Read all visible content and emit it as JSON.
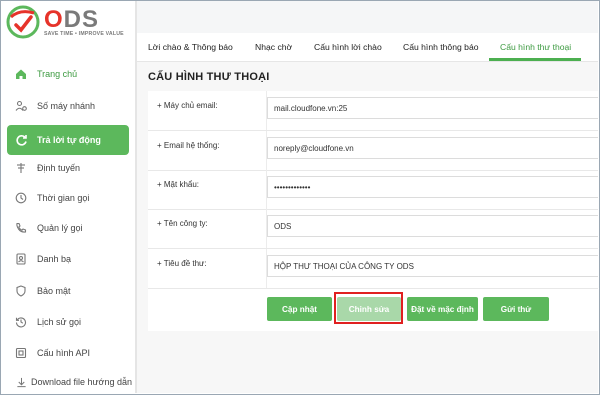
{
  "brand": {
    "logo_text": "ODS",
    "slogan": "SAVE TIME • IMPROVE VALUE",
    "colors": {
      "accent_green": "#5cb85c",
      "logo_red": "#e6332a",
      "logo_gray": "#7a7a7a",
      "highlight_red": "#e02020"
    }
  },
  "sidebar": {
    "items": [
      {
        "label": "Trang chủ",
        "icon": "home-icon",
        "active": false
      },
      {
        "label": "Số máy nhánh",
        "icon": "users-icon",
        "active": false
      },
      {
        "label": "Trả lời tự động",
        "icon": "refresh-icon",
        "active": true
      },
      {
        "label": "Định tuyến",
        "icon": "signpost-icon",
        "active": false
      },
      {
        "label": "Thời gian gọi",
        "icon": "clock-icon",
        "active": false
      },
      {
        "label": "Quản lý gọi",
        "icon": "phone-icon",
        "active": false
      },
      {
        "label": "Danh bạ",
        "icon": "contacts-icon",
        "active": false
      },
      {
        "label": "Bảo mật",
        "icon": "shield-icon",
        "active": false
      },
      {
        "label": "Lịch sử gọi",
        "icon": "history-icon",
        "active": false
      },
      {
        "label": "Cấu hình API",
        "icon": "api-icon",
        "active": false
      },
      {
        "label": "Download file hướng dẫn",
        "icon": "download-icon",
        "active": false
      }
    ]
  },
  "tabs": [
    {
      "label": "Lời chào & Thông báo",
      "active": false
    },
    {
      "label": "Nhạc chờ",
      "active": false
    },
    {
      "label": "Cấu hình lời chào",
      "active": false
    },
    {
      "label": "Cấu hình thông báo",
      "active": false
    },
    {
      "label": "Cấu hình thư thoại",
      "active": true
    }
  ],
  "page": {
    "title": "CẤU HÌNH THƯ THOẠI"
  },
  "form": {
    "fields": [
      {
        "label": "+ Máy chủ email:",
        "value": "mail.cloudfone.vn:25"
      },
      {
        "label": "+ Email hệ thống:",
        "value": "noreply@cloudfone.vn"
      },
      {
        "label": "+ Mật khẩu:",
        "value": "•••••••••••••"
      },
      {
        "label": "+ Tên công ty:",
        "value": "ODS"
      },
      {
        "label": "+ Tiêu đề thư:",
        "value": "HỘP THƯ THOẠI CỦA CÔNG TY ODS"
      }
    ]
  },
  "buttons": {
    "update": "Cập nhật",
    "edit": "Chỉnh sửa",
    "reset": "Đặt về mặc định",
    "send": "Gửi thử"
  }
}
